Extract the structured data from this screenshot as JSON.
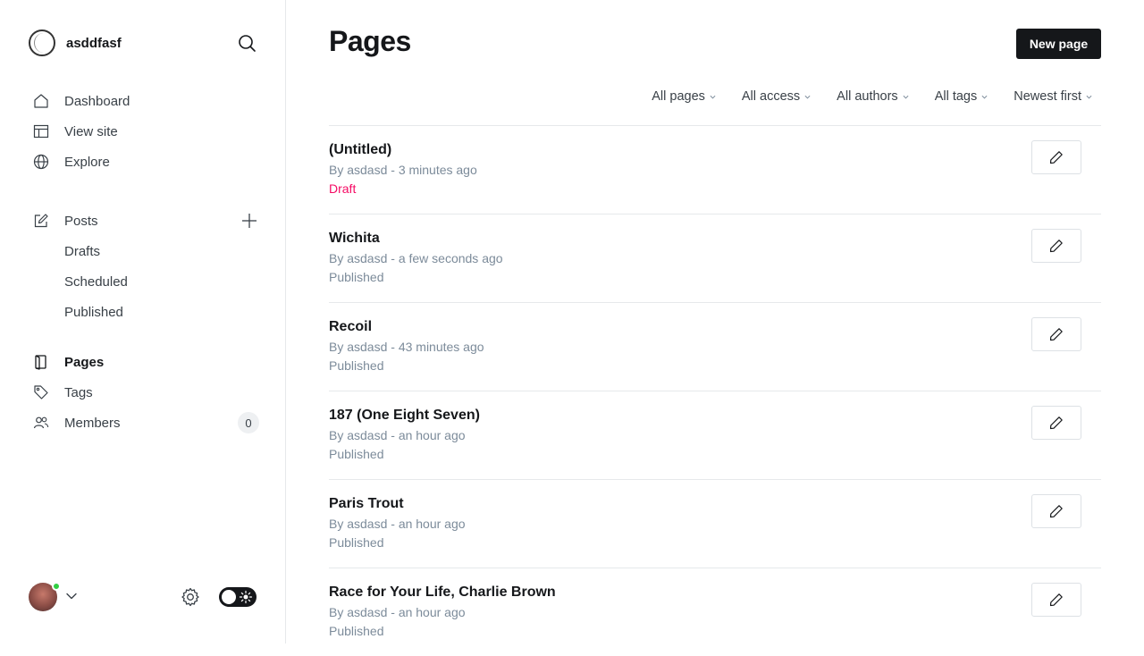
{
  "site": {
    "name": "asddfasf"
  },
  "nav": {
    "dashboard": "Dashboard",
    "view_site": "View site",
    "explore": "Explore",
    "posts": "Posts",
    "drafts": "Drafts",
    "scheduled": "Scheduled",
    "published": "Published",
    "pages": "Pages",
    "tags": "Tags",
    "members": "Members",
    "members_count": "0"
  },
  "main": {
    "title": "Pages",
    "new_button": "New page",
    "filters": {
      "type": "All pages",
      "access": "All access",
      "authors": "All authors",
      "tags": "All tags",
      "sort": "Newest first"
    },
    "rows": [
      {
        "title": "(Untitled)",
        "meta": "By asdasd - 3 minutes ago",
        "status": "Draft"
      },
      {
        "title": "Wichita",
        "meta": "By asdasd - a few seconds ago",
        "status": "Published"
      },
      {
        "title": "Recoil",
        "meta": "By asdasd - 43 minutes ago",
        "status": "Published"
      },
      {
        "title": "187 (One Eight Seven)",
        "meta": "By asdasd - an hour ago",
        "status": "Published"
      },
      {
        "title": "Paris Trout",
        "meta": "By asdasd - an hour ago",
        "status": "Published"
      },
      {
        "title": "Race for Your Life, Charlie Brown",
        "meta": "By asdasd - an hour ago",
        "status": "Published"
      }
    ]
  },
  "colors": {
    "accent_dark": "#15171a",
    "draft": "#f50b64",
    "muted": "#7c8b9a",
    "online": "#30cf43"
  },
  "icons": [
    "search-icon",
    "home-icon",
    "view-site-icon",
    "globe-icon",
    "edit-posts-icon",
    "plus-icon",
    "page-icon",
    "tag-icon",
    "members-icon",
    "chevron-down-icon",
    "gear-icon",
    "sun-icon",
    "pencil-icon"
  ]
}
